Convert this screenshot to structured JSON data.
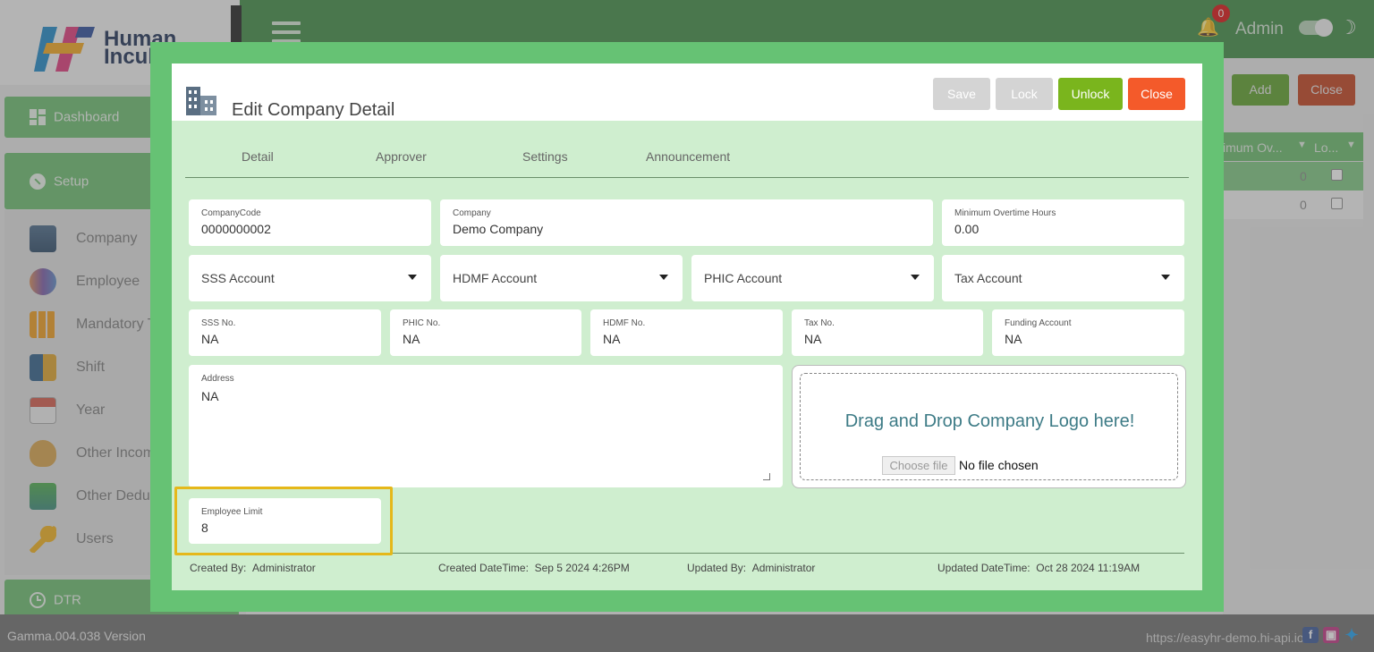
{
  "app": {
    "brand_line1": "Human",
    "brand_line2": "Incub",
    "admin_label": "Admin",
    "notification_count": "0",
    "version": "Gamma.004.038 Version",
    "url": "https://easyhr-demo.hi-api.io",
    "colors": {
      "topbar": "#3f8c44",
      "accent": "#6cbd6f",
      "danger": "#e8572a",
      "unlock": "#7ab51d"
    }
  },
  "sidebar": {
    "dashboard": "Dashboard",
    "setup": "Setup",
    "items": [
      {
        "label": "Company",
        "icon": "building-icon"
      },
      {
        "label": "Employee",
        "icon": "employees-icon"
      },
      {
        "label": "Mandatory Ta",
        "icon": "grid-icon"
      },
      {
        "label": "Shift",
        "icon": "shift-icon"
      },
      {
        "label": "Year",
        "icon": "calendar-icon"
      },
      {
        "label": "Other Income",
        "icon": "money-bag-icon"
      },
      {
        "label": "Other Deduc",
        "icon": "deduction-icon"
      },
      {
        "label": "Users",
        "icon": "key-icon"
      }
    ],
    "dtr": "DTR"
  },
  "background_page": {
    "add_label": "Add",
    "close_label": "Close",
    "col1": "imum Ov...",
    "col2": "Lo...",
    "rows": [
      {
        "value": "0"
      },
      {
        "value": "0"
      }
    ]
  },
  "modal": {
    "title": "Edit Company Detail",
    "buttons": {
      "save": "Save",
      "lock": "Lock",
      "unlock": "Unlock",
      "close": "Close"
    },
    "tabs": [
      "Detail",
      "Approver",
      "Settings",
      "Announcement"
    ],
    "fields": {
      "company_code": {
        "label": "CompanyCode",
        "value": "0000000002"
      },
      "company": {
        "label": "Company",
        "value": "Demo Company"
      },
      "min_ot_hours": {
        "label": "Minimum Overtime Hours",
        "value": "0.00"
      },
      "sss_account": "SSS Account",
      "hdmf_account": "HDMF Account",
      "phic_account": "PHIC Account",
      "tax_account": "Tax Account",
      "sss_no": {
        "label": "SSS No.",
        "value": "NA"
      },
      "phic_no": {
        "label": "PHIC No.",
        "value": "NA"
      },
      "hdmf_no": {
        "label": "HDMF No.",
        "value": "NA"
      },
      "tax_no": {
        "label": "Tax No.",
        "value": "NA"
      },
      "funding_account": {
        "label": "Funding Account",
        "value": "NA"
      },
      "address": {
        "label": "Address",
        "value": "NA"
      },
      "employee_limit": {
        "label": "Employee Limit",
        "value": "8"
      }
    },
    "logo_drop": {
      "text": "Drag and Drop Company Logo here!",
      "choose_file": "Choose file",
      "status": "No file chosen"
    },
    "footer": {
      "created_by_label": "Created By:",
      "created_by": "Administrator",
      "created_dt_label": "Created DateTime:",
      "created_dt": "Sep 5 2024 4:26PM",
      "updated_by_label": "Updated By:",
      "updated_by": "Administrator",
      "updated_dt_label": "Updated DateTime:",
      "updated_dt": "Oct 28 2024 11:19AM"
    }
  }
}
